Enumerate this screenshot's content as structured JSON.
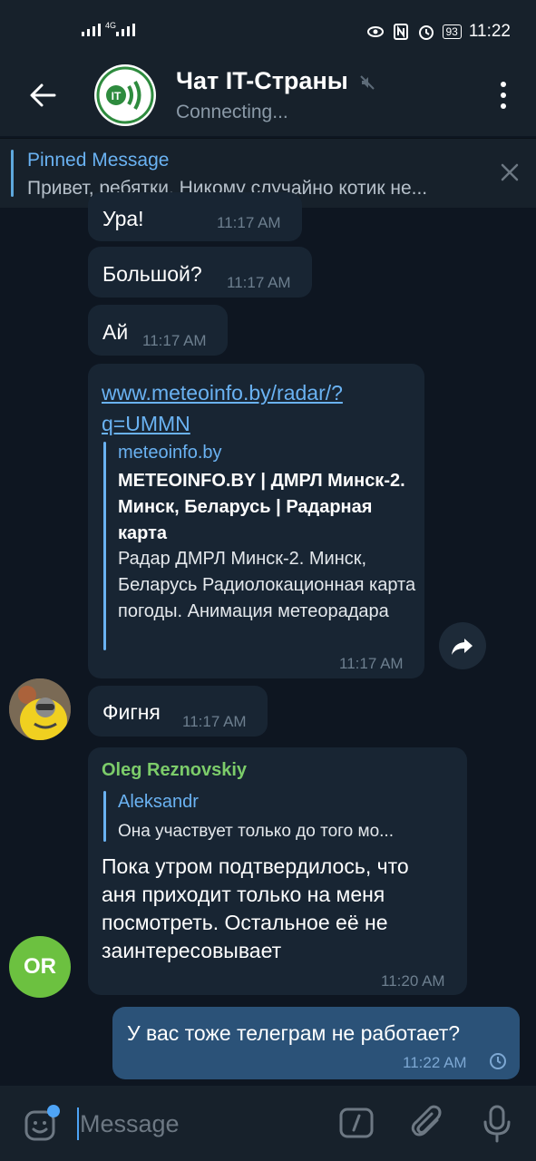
{
  "status_bar": {
    "network": "4G",
    "battery": "93",
    "time": "11:22"
  },
  "header": {
    "title": "Чат IT-Страны",
    "status": "Connecting...",
    "avatar_text": "IT"
  },
  "pinned": {
    "title": "Pinned Message",
    "text": "Привет, ребятки. Никому случайно котик не..."
  },
  "messages": [
    {
      "text": "Ура!",
      "time": "11:17 AM"
    },
    {
      "text": "Большой?",
      "time": "11:17 AM"
    },
    {
      "text": "Ай",
      "time": "11:17 AM"
    },
    {
      "link_line1": "www.meteoinfo.by/radar/?",
      "link_line2": "q=UMMN",
      "preview_site": "meteoinfo.by",
      "preview_title": "METEOINFO.BY | ДМРЛ Минск-2. Минск, Беларусь | Радарная карта",
      "preview_desc": "Радар ДМРЛ Минск-2. Минск, Беларусь Радиолокационная карта погоды. Анимация метеорадара",
      "time": "11:17 AM"
    },
    {
      "text": "Фигня",
      "time": "11:17 AM"
    },
    {
      "sender": "Oleg Reznovskiy",
      "reply_name": "Aleksandr",
      "reply_text": "Она участвует только до того мо...",
      "text": "Пока утром подтвердилось, что аня приходит только на меня посмотреть. Остальное её не заинтересовывает",
      "time": "11:20 AM",
      "avatar_initials": "OR"
    },
    {
      "text": "У вас тоже телеграм не работает?",
      "time": "11:22 AM"
    }
  ],
  "composer": {
    "placeholder": "Message"
  },
  "colors": {
    "background": "#0e1621",
    "bar": "#17212b",
    "incoming": "#182533",
    "outgoing": "#2b5278",
    "accent": "#6ab2f2",
    "sender": "#7ccc6a"
  },
  "icons": [
    "back-arrow-icon",
    "mute-icon",
    "more-vert-icon",
    "close-icon",
    "share-icon",
    "clock-icon",
    "emoji-icon",
    "command-icon",
    "attach-icon",
    "mic-icon"
  ]
}
